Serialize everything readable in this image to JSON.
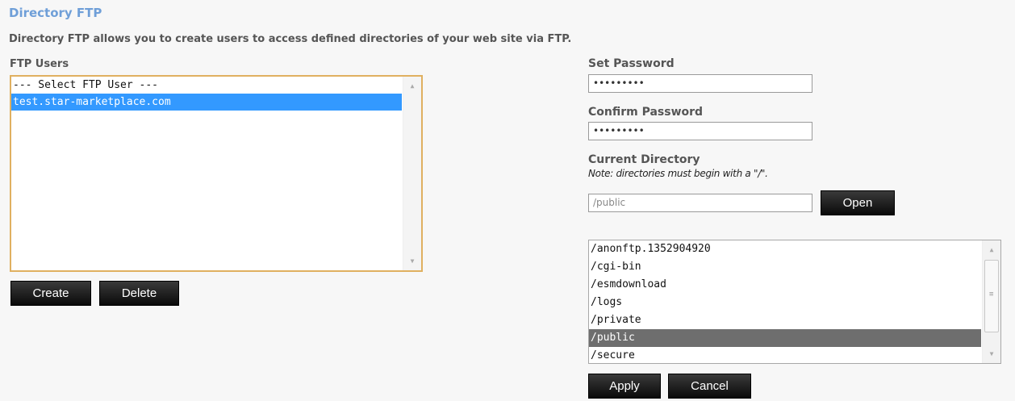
{
  "header": {
    "title": "Directory FTP",
    "description": "Directory FTP allows you to create users to access defined directories of your web site via FTP."
  },
  "ftp_users": {
    "label": "FTP Users",
    "options": [
      "--- Select FTP User ---",
      "test.star-marketplace.com"
    ],
    "selected_index": 1,
    "create_label": "Create",
    "delete_label": "Delete"
  },
  "password": {
    "set_label": "Set Password",
    "set_value": "•••••••••",
    "confirm_label": "Confirm Password",
    "confirm_value": "•••••••••"
  },
  "directory": {
    "label": "Current Directory",
    "note": "Note: directories must begin with a \"/\".",
    "value": "/public",
    "open_label": "Open",
    "options": [
      "/anonftp.1352904920",
      "/cgi-bin",
      "/esmdownload",
      "/logs",
      "/private",
      "/public",
      "/secure"
    ],
    "selected_index": 5
  },
  "actions": {
    "apply_label": "Apply",
    "cancel_label": "Cancel"
  },
  "colors": {
    "title": "#6f9fd8",
    "user_selected": "#3399ff",
    "dir_selected": "#6e6e6e",
    "listbox_focus_border": "#e0b060"
  },
  "icons": {
    "scroll_up": "chevron-up-icon",
    "scroll_down": "chevron-down-icon",
    "scroll_grip": "grip-icon"
  }
}
